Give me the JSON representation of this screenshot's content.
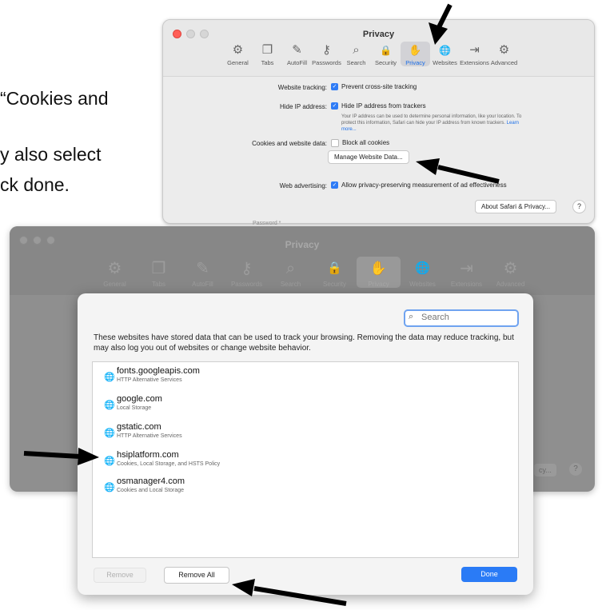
{
  "doc_text": {
    "line1": "“Cookies and",
    "line2": "y also select",
    "line3": "ck done."
  },
  "top_window": {
    "title": "Privacy",
    "toolbar": [
      {
        "label": "General",
        "icon": "gear-icon",
        "glyph": "⚙"
      },
      {
        "label": "Tabs",
        "icon": "tabs-icon",
        "glyph": "❐"
      },
      {
        "label": "AutoFill",
        "icon": "autofill-icon",
        "glyph": "✎"
      },
      {
        "label": "Passwords",
        "icon": "key-icon",
        "glyph": "⚷"
      },
      {
        "label": "Search",
        "icon": "search-icon",
        "glyph": "⌕"
      },
      {
        "label": "Security",
        "icon": "lock-icon",
        "glyph": "🔒"
      },
      {
        "label": "Privacy",
        "icon": "hand-icon",
        "glyph": "✋",
        "selected": true
      },
      {
        "label": "Websites",
        "icon": "globe-icon",
        "glyph": "🌐"
      },
      {
        "label": "Extensions",
        "icon": "extensions-icon",
        "glyph": "⇥"
      },
      {
        "label": "Advanced",
        "icon": "advanced-gears-icon",
        "glyph": "⚙"
      }
    ],
    "website_tracking_label": "Website tracking:",
    "website_tracking_value": "Prevent cross-site tracking",
    "hide_ip_label": "Hide IP address:",
    "hide_ip_value": "Hide IP address from trackers",
    "hide_ip_desc": "Your IP address can be used to determine personal information, like your location. To protect this information, Safari can hide your IP address from known trackers.",
    "learn_more": "Learn more...",
    "cookies_label": "Cookies and website data:",
    "cookies_value": "Block all cookies",
    "manage_button": "Manage Website Data...",
    "web_ad_label": "Web advertising:",
    "web_ad_value": "Allow privacy-preserving measurement of ad effectiveness",
    "about_button": "About Safari & Privacy...",
    "help": "?",
    "password_label": "Password *"
  },
  "bottom_window": {
    "title": "Privacy",
    "toolbar": [
      {
        "label": "General",
        "glyph": "⚙"
      },
      {
        "label": "Tabs",
        "glyph": "❐"
      },
      {
        "label": "AutoFill",
        "glyph": "✎"
      },
      {
        "label": "Passwords",
        "glyph": "⚷"
      },
      {
        "label": "Search",
        "glyph": "⌕"
      },
      {
        "label": "Security",
        "glyph": "🔒"
      },
      {
        "label": "Privacy",
        "glyph": "✋",
        "selected": true
      },
      {
        "label": "Websites",
        "glyph": "🌐"
      },
      {
        "label": "Extensions",
        "glyph": "⇥"
      },
      {
        "label": "Advanced",
        "glyph": "⚙"
      }
    ],
    "partial_button": "cy...",
    "help": "?"
  },
  "sheet": {
    "search_placeholder": "Search",
    "description": "These websites have stored data that can be used to track your browsing. Removing the data may reduce tracking, but may also log you out of websites or change website behavior.",
    "sites": [
      {
        "name": "fonts.googleapis.com",
        "detail": "HTTP Alternative Services"
      },
      {
        "name": "google.com",
        "detail": "Local Storage"
      },
      {
        "name": "gstatic.com",
        "detail": "HTTP Alternative Services"
      },
      {
        "name": "hsiplatform.com",
        "detail": "Cookies, Local Storage, and HSTS Policy"
      },
      {
        "name": "osmanager4.com",
        "detail": "Cookies and Local Storage"
      }
    ],
    "remove_button": "Remove",
    "remove_all_button": "Remove All",
    "done_button": "Done"
  },
  "colors": {
    "accent_blue": "#2a7bf6",
    "arrow": "#000000"
  }
}
